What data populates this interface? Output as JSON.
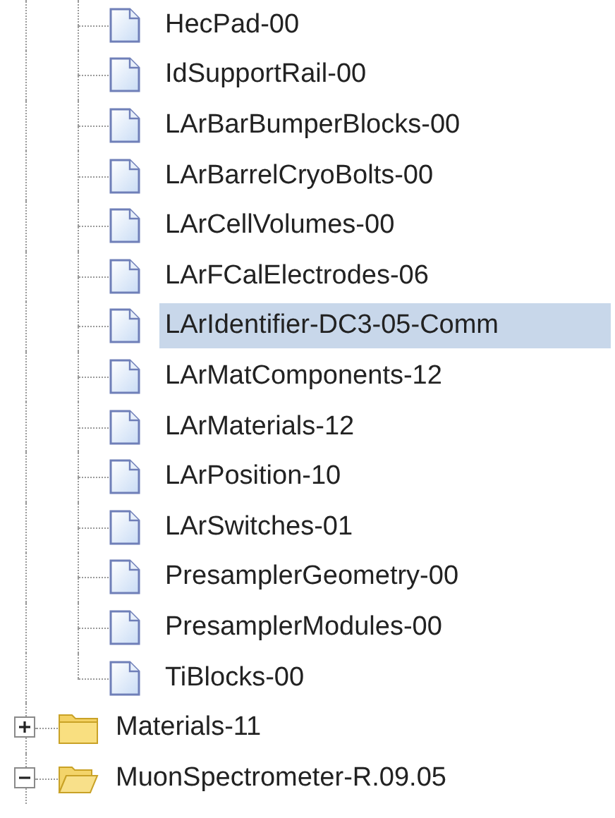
{
  "tree": [
    {
      "kind": "folder_continued",
      "children": [
        {
          "kind": "file",
          "label": "HecPad-00",
          "selected": false
        },
        {
          "kind": "file",
          "label": "IdSupportRail-00",
          "selected": false
        },
        {
          "kind": "file",
          "label": "LArBarBumperBlocks-00",
          "selected": false
        },
        {
          "kind": "file",
          "label": "LArBarrelCryoBolts-00",
          "selected": false
        },
        {
          "kind": "file",
          "label": "LArCellVolumes-00",
          "selected": false
        },
        {
          "kind": "file",
          "label": "LArFCalElectrodes-06",
          "selected": false
        },
        {
          "kind": "file",
          "label": "LArIdentifier-DC3-05-Comm",
          "selected": true
        },
        {
          "kind": "file",
          "label": "LArMatComponents-12",
          "selected": false
        },
        {
          "kind": "file",
          "label": "LArMaterials-12",
          "selected": false
        },
        {
          "kind": "file",
          "label": "LArPosition-10",
          "selected": false
        },
        {
          "kind": "file",
          "label": "LArSwitches-01",
          "selected": false
        },
        {
          "kind": "file",
          "label": "PresamplerGeometry-00",
          "selected": false
        },
        {
          "kind": "file",
          "label": "PresamplerModules-00",
          "selected": false
        },
        {
          "kind": "file",
          "label": "TiBlocks-00",
          "selected": false
        }
      ]
    },
    {
      "kind": "folder",
      "label": "Materials-11",
      "expanded": false,
      "selected": false
    },
    {
      "kind": "folder",
      "label": "MuonSpectrometer-R.09.05",
      "expanded": true,
      "selected": false
    }
  ]
}
